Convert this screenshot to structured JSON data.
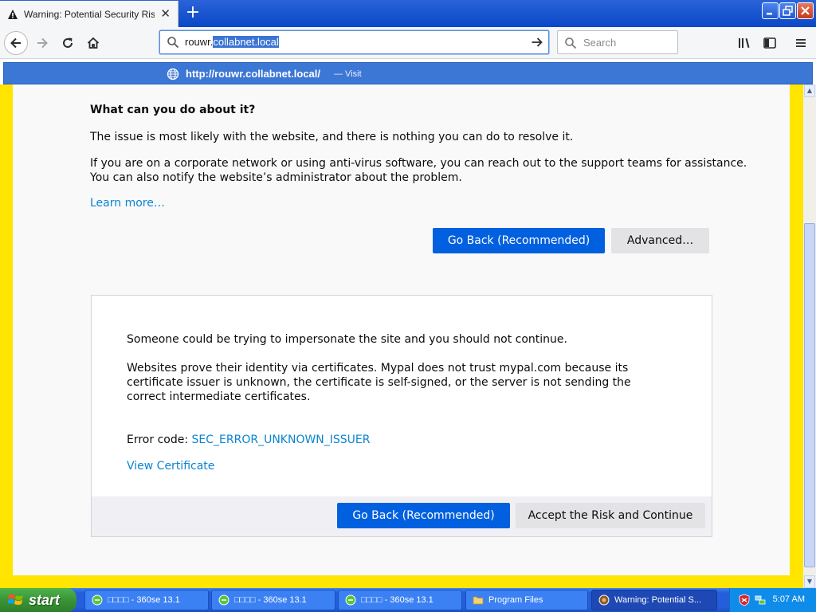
{
  "browser": {
    "tab": {
      "title": "Warning: Potential Security Risk A",
      "close_label": "✕"
    },
    "new_tab_label": "+",
    "url": {
      "unselected": "rouwr.",
      "selected": "collabnet.local"
    },
    "search_placeholder": "Search",
    "suggestion": {
      "url": "http://rouwr.collabnet.local/",
      "action": "— Visit"
    }
  },
  "page": {
    "heading": "What can you do about it?",
    "p1": "The issue is most likely with the website, and there is nothing you can do to resolve it.",
    "p2_line1": "If you are on a corporate network or using anti-virus software, you can reach out to the support teams for assistance.",
    "p2_line2": "You can also notify the website’s administrator about the problem.",
    "learn_more": "Learn more…",
    "go_back": "Go Back (Recommended)",
    "advanced": "Advanced…"
  },
  "advanced_panel": {
    "line1": "Someone could be trying to impersonate the site and you should not continue.",
    "line2": "Websites prove their identity via certificates. Mypal does not trust mypal.com because its certificate issuer is unknown, the certificate is self-signed, or the server is not sending the correct intermediate certificates.",
    "error_label": "Error code:",
    "error_code": "SEC_ERROR_UNKNOWN_ISSUER",
    "view_certificate": "View Certificate",
    "go_back": "Go Back (Recommended)",
    "accept": "Accept the Risk and Continue"
  },
  "taskbar": {
    "start": "start",
    "tasks": [
      {
        "label": "□□□□ - 360se 13.1"
      },
      {
        "label": "□□□□ - 360se 13.1"
      },
      {
        "label": "□□□□ - 360se 13.1"
      },
      {
        "label": "Program Files"
      },
      {
        "label": "Warning: Potential S..."
      }
    ],
    "clock": "5:07 AM"
  },
  "colors": {
    "accent_blue": "#0060df",
    "link_blue": "#0a84d1",
    "page_border_yellow": "#ffe500"
  }
}
